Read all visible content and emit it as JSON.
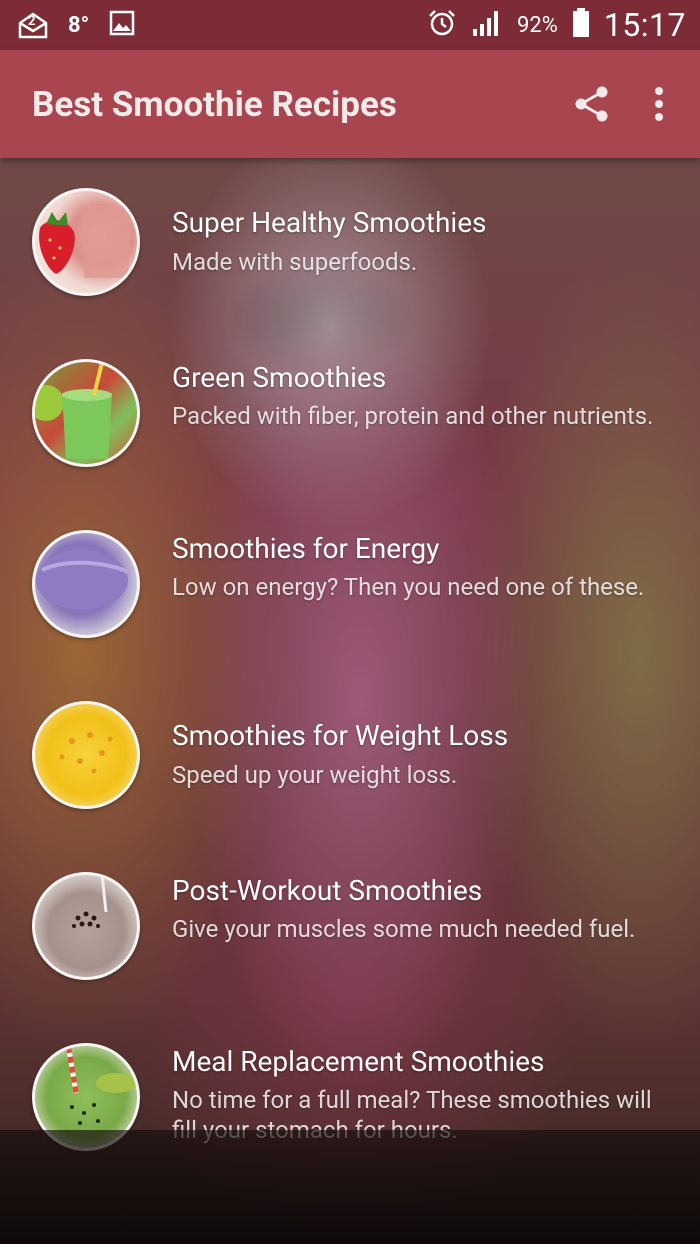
{
  "status_bar": {
    "notification_count": "2",
    "temperature": "8°",
    "battery_percent": "92%",
    "time": "15:17"
  },
  "app_bar": {
    "title": "Best Smoothie Recipes",
    "share_icon": "share-icon",
    "menu_icon": "more-vert-icon"
  },
  "categories": [
    {
      "title": "Super Healthy Smoothies",
      "description": "Made with superfoods."
    },
    {
      "title": "Green Smoothies",
      "description": "Packed with fiber, protein and other nutrients."
    },
    {
      "title": "Smoothies for Energy",
      "description": "Low on energy? Then you need one of these."
    },
    {
      "title": "Smoothies for Weight Loss",
      "description": "Speed up your weight loss."
    },
    {
      "title": "Post-Workout Smoothies",
      "description": "Give your muscles some much needed fuel."
    },
    {
      "title": "Meal Replacement Smoothies",
      "description": "No time for a full meal? These smoothies will fill your stomach for hours."
    }
  ],
  "colors": {
    "status_bar": "#7d2c37",
    "app_bar": "#a8454f"
  }
}
